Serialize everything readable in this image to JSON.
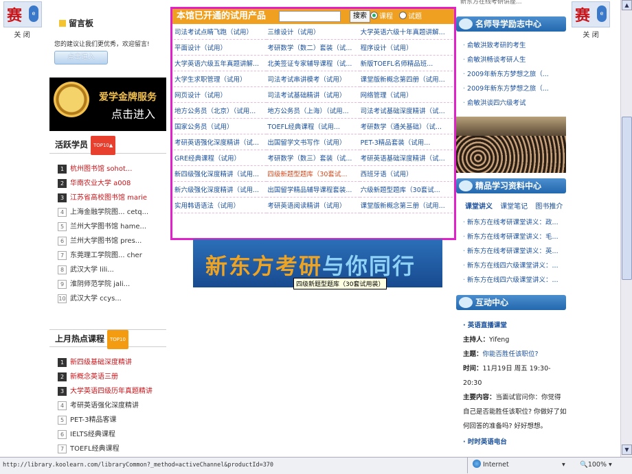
{
  "ads": {
    "badge_char": "赛",
    "close_label": "关 闭"
  },
  "guestbook": {
    "title": "留言板",
    "desc": "您的建议让我们更优秀，欢迎留言!",
    "button": "点击进入"
  },
  "gold_service": {
    "line1": "爱学金牌服务",
    "line2": "点击进入"
  },
  "active_members": {
    "title": "活跃学员",
    "tag": "TOP10▲",
    "items": [
      {
        "n": "1",
        "text": "杭州图书馆 sohot..."
      },
      {
        "n": "2",
        "text": "华南农业大学 a008"
      },
      {
        "n": "3",
        "text": "江苏省高校图书馆 marie"
      },
      {
        "n": "4",
        "text": "上海金融学院图... cetq..."
      },
      {
        "n": "5",
        "text": "兰州大学图书馆 hame..."
      },
      {
        "n": "6",
        "text": "兰州大学图书馆 pres..."
      },
      {
        "n": "7",
        "text": "东莞理工学院图... cher"
      },
      {
        "n": "8",
        "text": "武汉大学 lili..."
      },
      {
        "n": "9",
        "text": "淮阴师范学院 jali..."
      },
      {
        "n": "10",
        "text": "武汉大学 ccys..."
      }
    ]
  },
  "hot_courses": {
    "title": "上月热点课程",
    "tag": "TOP10",
    "items": [
      {
        "n": "1",
        "text": "新四级基础深度精讲"
      },
      {
        "n": "2",
        "text": "新概念英语三册"
      },
      {
        "n": "3",
        "text": "大学英语四级历年真题精讲"
      },
      {
        "n": "4",
        "text": "考研英语强化深度精讲"
      },
      {
        "n": "5",
        "text": "PET-3精品客课"
      },
      {
        "n": "6",
        "text": "IELTS经典课程"
      },
      {
        "n": "7",
        "text": "TOEFL经典课程"
      }
    ]
  },
  "products": {
    "title": "本馆已开通的试用产品",
    "search_button": "搜索",
    "radio_course": "课程",
    "radio_exam": "试题",
    "rows": [
      [
        "司法考试点睛飞跑（试用）",
        "三维设计（试用）",
        "大学英语六级十年真题讲解..."
      ],
      [
        "平面设计（试用）",
        "考研数学（数二）套装（试...",
        "程序设计（试用）"
      ],
      [
        "大学英语六级五年真题讲解...",
        "北美签证专家辅导课程（试...",
        "新版TOEFL名师精品班..."
      ],
      [
        "大学生求职管理（试用）",
        "司法考试串讲模考（试用）",
        "课堂版新概念第四册（试用..."
      ],
      [
        "网页设计（试用）",
        "司法考试基础精讲（试用）",
        "网络管理（试用）"
      ],
      [
        "地方公务员（北京）（试用...",
        "地方公务员（上海）（试用...",
        "司法考试基础深度精讲（试..."
      ],
      [
        "国家公务员（试用）",
        "TOEFL经典课程（试用...",
        "考研数学（通关基础）（试..."
      ],
      [
        "考研英语强化深度精讲（试...",
        "出国留学文书写作（试用）",
        "PET-3精品套装（试用..."
      ],
      [
        "GRE经典课程（试用）",
        "考研数学（数三）套装（试...",
        "考研英语基础深度精讲（试..."
      ],
      [
        "新四级强化深度精讲（试用...",
        "四级新题型题库（30套试...",
        "西班牙语（试用）"
      ],
      [
        "新六级强化深度精讲（试用...",
        "出国留学精品辅导课程套装...",
        "六级新题型题库（30套试..."
      ],
      [
        "实用韩语语法（试用）",
        "考研英语阅读精讲（试用）",
        "课堂版新概念第三册（试用..."
      ]
    ]
  },
  "banner": {
    "part1": "新东方考研",
    "part2": "与你同行"
  },
  "tooltip": "四级新题型题库（30套试用装）",
  "right": {
    "top_partial": "新东方在线考研讲座...",
    "teacher_title": "名师导学励志中心",
    "teacher_items": [
      "俞敏洪致考研的考生",
      "俞敏洪畅谈考研人生",
      "2009年新东方梦想之旅（...",
      "2009年新东方梦想之旅（...",
      "俞敏洪谈四六级考试"
    ],
    "materials_title": "精品学习资料中心",
    "materials_tabs": [
      "课堂讲义",
      "课堂笔记",
      "图书推介"
    ],
    "materials_items": [
      "新东方在线考研课堂讲义：政...",
      "新东方在线考研课堂讲义：毛...",
      "新东方在线考研课堂讲义：英...",
      "新东方在线四六级课堂讲义：...",
      "新东方在线四六级课堂讲义：..."
    ],
    "interactive_title": "互动中心",
    "live_title": "英语直播课堂",
    "host_label": "主持人：",
    "host": "Yifeng",
    "topic_label": "主题：",
    "topic": "你能否胜任该职位?",
    "time_label": "时间：",
    "time": "11月19日 周五 19:30-20:30",
    "content_label": "主要内容：",
    "content": "当面试官问你：你觉得自己是否能胜任该职位? 你做好了如何回答的准备吗? 好好想想。",
    "radio_title": "时时英语电台"
  },
  "statusbar": {
    "url": "http://library.koolearn.com/libraryCommon?_method=activeChannel&productId=370",
    "zone": "Internet",
    "zoom": "100%"
  }
}
